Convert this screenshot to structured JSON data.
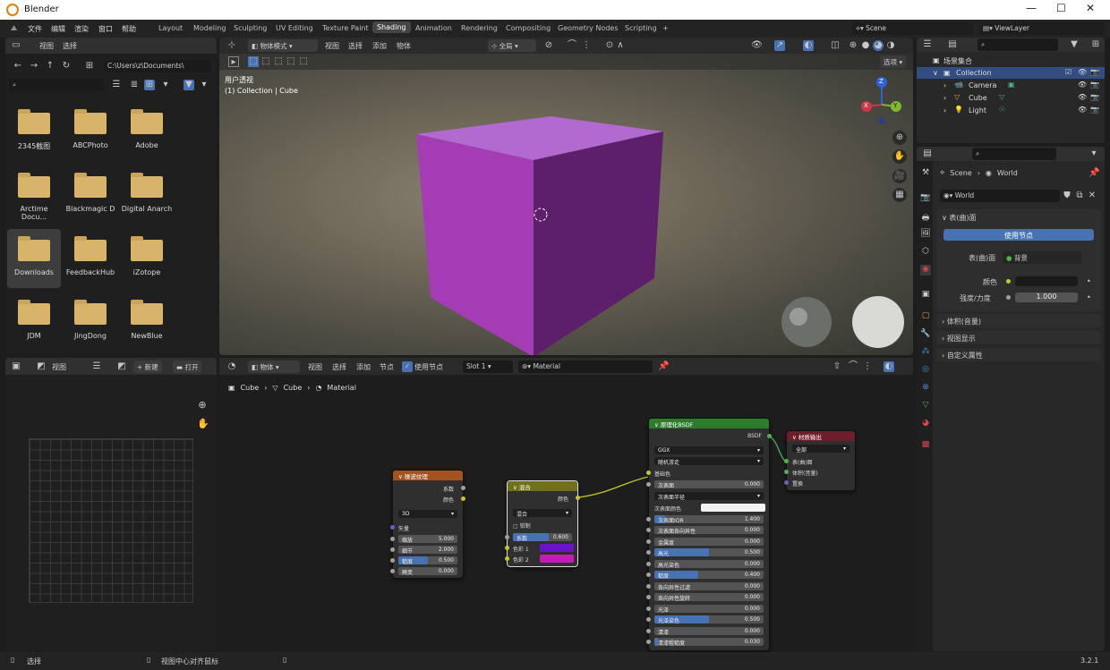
{
  "window": {
    "title": "Blender",
    "version": "3.2.1",
    "min": "—",
    "max": "☐",
    "close": "✕"
  },
  "menu": [
    "文件",
    "编辑",
    "渲染",
    "窗口",
    "帮助"
  ],
  "workspaces": [
    "Layout",
    "Modeling",
    "Sculpting",
    "UV Editing",
    "Texture Paint",
    "Shading",
    "Animation",
    "Rendering",
    "Compositing",
    "Geometry Nodes",
    "Scripting",
    "+"
  ],
  "scene_field": "Scene",
  "viewlayer_field": "ViewLayer",
  "file_browser": {
    "menu": [
      "视图",
      "选择"
    ],
    "path": "C:\\Users\\z\\Documents\\",
    "folders": [
      "2345截图",
      "ABCPhoto",
      "Adobe",
      "Arctime Docu...",
      "Blackmagic D",
      "Digital Anarch",
      "Downloads",
      "FeedbackHub",
      "iZotope",
      "JDM",
      "JingDong",
      "NewBlue"
    ],
    "selected": "Downloads"
  },
  "image_editor": {
    "view": "视图",
    "new": "新建",
    "open": "打开"
  },
  "viewport": {
    "mode": "物体模式",
    "menu": [
      "视图",
      "选择",
      "添加",
      "物体"
    ],
    "orientation": "全局",
    "options": "选项",
    "view_name": "用户透视",
    "collection_info": "(1) Collection | Cube",
    "gizmo": {
      "x": "X",
      "y": "Y",
      "z": "Z"
    }
  },
  "node_editor": {
    "mode": "物体",
    "menu": [
      "视图",
      "选择",
      "添加",
      "节点"
    ],
    "use_nodes": "使用节点",
    "slot": "Slot 1",
    "material": "Material",
    "breadcrumb": [
      "Cube",
      "Cube",
      "Material"
    ]
  },
  "noise_node": {
    "title": "噪波纹理",
    "out1": "系数",
    "out2": "颜色",
    "dim": "3D",
    "vector": "矢量",
    "fields": [
      {
        "label": "缩放",
        "value": "5.000",
        "fill": 0
      },
      {
        "label": "细节",
        "value": "2.000",
        "fill": 0
      },
      {
        "label": "糙度",
        "value": "0.500",
        "fill": 0.5
      },
      {
        "label": "畸变",
        "value": "0.000",
        "fill": 0
      }
    ]
  },
  "mix_node": {
    "title": "混合",
    "out": "颜色",
    "blend": "混合",
    "clamp": "钳制",
    "factor": {
      "label": "系数",
      "value": "0.600",
      "fill": 0.6
    },
    "color1": "色彩 1",
    "color2": "色彩 2",
    "c1_hex": "#6a13c9",
    "c2_hex": "#c81ab5"
  },
  "bsdf_node": {
    "title": "原理化BSDF",
    "out": "BSDF",
    "dist": "GGX",
    "sss": "随机游走",
    "base": "基础色",
    "sss_radius": "次表面半径",
    "sss_color": "次表面颜色",
    "fields": [
      {
        "label": "次表面",
        "value": "0.000",
        "fill": 0
      },
      {
        "label": "次表面IOR",
        "value": "1.400",
        "fill": 0.1
      },
      {
        "label": "次表面各向异性",
        "value": "0.000",
        "fill": 0
      },
      {
        "label": "金属度",
        "value": "0.000",
        "fill": 0
      },
      {
        "label": "高光",
        "value": "0.500",
        "fill": 0.5
      },
      {
        "label": "高光染色",
        "value": "0.000",
        "fill": 0
      },
      {
        "label": "糙度",
        "value": "0.400",
        "fill": 0.4
      },
      {
        "label": "各向异性过滤",
        "value": "0.000",
        "fill": 0
      },
      {
        "label": "各向异性旋转",
        "value": "0.000",
        "fill": 0
      },
      {
        "label": "光泽",
        "value": "0.000",
        "fill": 0
      },
      {
        "label": "光泽染色",
        "value": "0.500",
        "fill": 0.5
      },
      {
        "label": "清漆",
        "value": "0.000",
        "fill": 0
      },
      {
        "label": "清漆粗糙度",
        "value": "0.030",
        "fill": 0.03
      }
    ]
  },
  "output_node": {
    "title": "材质输出",
    "target": "全部",
    "surface": "表(曲)面",
    "volume": "体积(音量)",
    "disp": "置换"
  },
  "outliner": {
    "root": "场景集合",
    "collection": "Collection",
    "items": [
      "Camera",
      "Cube",
      "Light"
    ]
  },
  "properties": {
    "breadcrumb": [
      "Scene",
      "World"
    ],
    "world_name": "World",
    "surface_section": "表(曲)面",
    "use_nodes": "使用节点",
    "surface_label": "表(曲)面",
    "surface_value": "背景",
    "color_label": "颜色",
    "strength_label": "强度/力度",
    "strength_value": "1.000",
    "sections": [
      "体积(音量)",
      "视图显示",
      "自定义属性"
    ]
  },
  "statusbar": {
    "select": "选择",
    "center": "视图中心对齐鼠标",
    "version": "3.2.1"
  },
  "colors": {
    "accent": "#4772b3",
    "cube_face": "#b23fc0"
  }
}
